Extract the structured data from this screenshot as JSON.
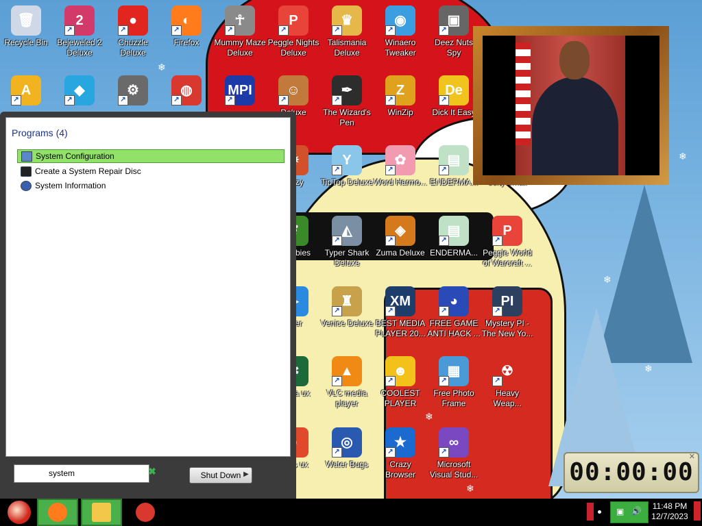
{
  "desktop": {
    "icons": [
      {
        "label": "Recycle Bin",
        "icon": "recycle-bin-icon",
        "color": "#cfd8e6",
        "glyph": "🗑"
      },
      {
        "label": "Bejeweled 2 Deluxe",
        "icon": "bejeweled-icon",
        "color": "#d23a6a",
        "glyph": "2"
      },
      {
        "label": "Chuzzle Deluxe",
        "icon": "chuzzle-icon",
        "color": "#e0261e",
        "glyph": "●"
      },
      {
        "label": "Firefox",
        "icon": "firefox-icon",
        "color": "#ff7b1c",
        "glyph": "◐"
      },
      {
        "label": "Mummy Maze Deluxe",
        "icon": "mummy-maze-icon",
        "color": "#8a8a8a",
        "glyph": "☥"
      },
      {
        "label": "Peggle Nights Deluxe",
        "icon": "peggle-icon",
        "color": "#e8443a",
        "glyph": "P"
      },
      {
        "label": "Talismania Deluxe",
        "icon": "talismania-icon",
        "color": "#e6b84a",
        "glyph": "♛"
      },
      {
        "label": "Winaero Tweaker",
        "icon": "winaero-icon",
        "color": "#3a9ee0",
        "glyph": "◉"
      },
      {
        "label": "Deez Nuts Spy",
        "icon": "deez-nuts-icon",
        "color": "#666666",
        "glyph": "▣"
      },
      {
        "label": "",
        "icon": "aimp-icon",
        "color": "#f2b320",
        "glyph": "A"
      },
      {
        "label": "",
        "icon": "diamond-icon",
        "color": "#27a6e0",
        "glyph": "◆"
      },
      {
        "label": "",
        "icon": "gear-icon",
        "color": "#6a6a6a",
        "glyph": "⚙"
      },
      {
        "label": "",
        "icon": "chrome-icon",
        "color": "#d9382f",
        "glyph": "◍"
      },
      {
        "label": "",
        "icon": "mpi-icon",
        "color": "#1c3aa8",
        "glyph": "MPI"
      },
      {
        "label": "Deluxe",
        "icon": "game-character-icon",
        "color": "#c27a3c",
        "glyph": "☺"
      },
      {
        "label": "The Wizard's Pen",
        "icon": "wizard-icon",
        "color": "#2d2d2d",
        "glyph": "✒"
      },
      {
        "label": "WinZip",
        "icon": "winzip-icon",
        "color": "#e0a21c",
        "glyph": "Z"
      },
      {
        "label": "Dick It Easy",
        "icon": "dick-it-easy-icon",
        "color": "#f0c41c",
        "glyph": "De"
      },
      {
        "label": "renzy",
        "icon": "frenzy-icon",
        "color": "#d0512a",
        "glyph": "✹"
      },
      {
        "label": "TipTop Deluxe",
        "icon": "tiptop-icon",
        "color": "#8ac6ea",
        "glyph": "Y"
      },
      {
        "label": "Word Harmo...",
        "icon": "word-harmony-icon",
        "color": "#f29ab0",
        "glyph": "✿"
      },
      {
        "label": "ENDERMA...",
        "icon": "enderman-icon",
        "color": "#bfe2c7",
        "glyph": "▤"
      },
      {
        "label": "sexy email",
        "icon": "email-icon",
        "color": "#f3f3f3",
        "glyph": ""
      },
      {
        "label": "ts vs bies",
        "icon": "plants-zombies-icon",
        "color": "#3b8a2a",
        "glyph": "❦"
      },
      {
        "label": "Typer Shark Deluxe",
        "icon": "typer-shark-icon",
        "color": "#7a8fa3",
        "glyph": "◭"
      },
      {
        "label": "Zuma Deluxe",
        "icon": "zuma-icon",
        "color": "#d47a1c",
        "glyph": "◈"
      },
      {
        "label": "ENDERMA...",
        "icon": "enderman-icon",
        "color": "#bfe2c7",
        "glyph": "▤"
      },
      {
        "label": "Peggle World of Warcraft ...",
        "icon": "peggle-wow-icon",
        "color": "#e8443a",
        "glyph": "P"
      },
      {
        "label": "layer",
        "icon": "player-icon",
        "color": "#2a8ae0",
        "glyph": "▶"
      },
      {
        "label": "Venice Deluxe",
        "icon": "venice-icon",
        "color": "#c8a24a",
        "glyph": "♜"
      },
      {
        "label": "BEST MEDIA PLAYER 20...",
        "icon": "xmplay-icon",
        "color": "#1d3d6a",
        "glyph": "XM"
      },
      {
        "label": "FREE GAME ANTI HACK ...",
        "icon": "anti-hack-icon",
        "color": "#2a4ab8",
        "glyph": "◕"
      },
      {
        "label": "Mystery PI - The New Yo...",
        "icon": "mystery-pi-icon",
        "color": "#2d4060",
        "glyph": "PI"
      },
      {
        "label": "Mania ux",
        "icon": "mania-icon",
        "color": "#1c6a3a",
        "glyph": "✱"
      },
      {
        "label": "VLC media player",
        "icon": "vlc-icon",
        "color": "#f08a14",
        "glyph": "▲"
      },
      {
        "label": "COOLEST PLAYER",
        "icon": "coolest-player-icon",
        "color": "#f2c21a",
        "glyph": "☻"
      },
      {
        "label": "Free Photo Frame",
        "icon": "photo-frame-icon",
        "color": "#4a9ad8",
        "glyph": "▦"
      },
      {
        "label": "Heavy Weap...",
        "icon": "heavy-weapon-icon",
        "color": "#d42a20",
        "glyph": "☢"
      },
      {
        "label": "Seas ux",
        "icon": "seas-icon",
        "color": "#e04a2a",
        "glyph": "◌"
      },
      {
        "label": "Water Bugs",
        "icon": "water-bugs-icon",
        "color": "#2a5ab0",
        "glyph": "◎"
      },
      {
        "label": "Crazy Browser",
        "icon": "crazy-browser-icon",
        "color": "#1a6ad0",
        "glyph": "★"
      },
      {
        "label": "Microsoft Visual Stud...",
        "icon": "visual-studio-icon",
        "color": "#7a48c0",
        "glyph": "∞"
      }
    ]
  },
  "start_menu": {
    "heading": "Programs (4)",
    "items": [
      {
        "label": "System Configuration",
        "selected": true
      },
      {
        "label": "Create a System Repair Disc",
        "selected": false
      },
      {
        "label": "System Information",
        "selected": false
      }
    ],
    "search_value": "system",
    "shutdown_label": "Shut Down"
  },
  "gadget": {
    "clock_display": "00:00:00"
  },
  "taskbar": {
    "time": "11:48 PM",
    "date": "12/7/2023",
    "pinned": [
      {
        "name": "firefox",
        "color": "#ff7b1c"
      },
      {
        "name": "explorer",
        "color": "#f2c84a"
      },
      {
        "name": "chrome",
        "color": "#d9382f"
      }
    ]
  },
  "colors": {
    "selection_green": "#92e26a",
    "start_menu_bg": "#3b3b3b",
    "taskbar_bg": "#000000"
  }
}
